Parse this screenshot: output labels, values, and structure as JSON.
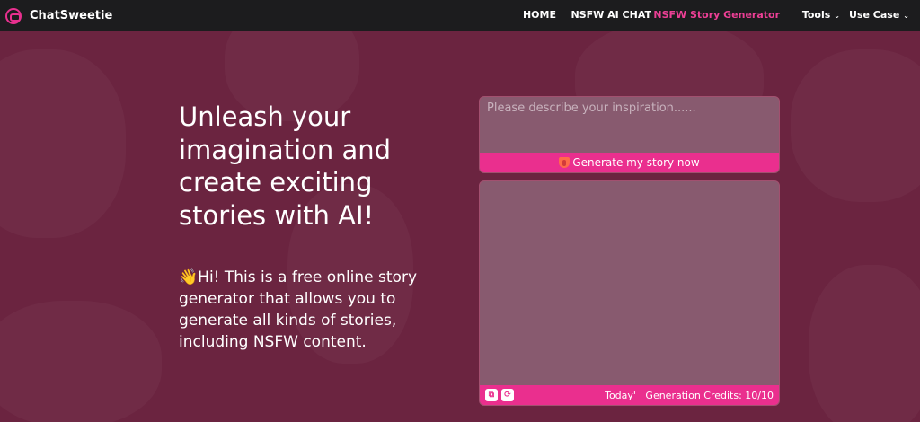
{
  "brand": {
    "name": "ChatSweetie",
    "logo_icon": "chat-bubble-icon",
    "accent": "#ea2f8e"
  },
  "nav": {
    "items": [
      {
        "label": "HOME",
        "active": false
      },
      {
        "label": "NSFW AI CHAT",
        "active": false
      },
      {
        "label": "NSFW Story Generator",
        "active": true
      },
      {
        "label": "Tools",
        "dropdown": true
      },
      {
        "label": "Use Case",
        "dropdown": true
      }
    ],
    "caret": "⌄"
  },
  "hero": {
    "title": "Unleash your imagination and create exciting stories with AI!",
    "description_emoji": "👋",
    "description": "Hi! This is a free online story generator that allows you to generate all kinds of stories, including NSFW content."
  },
  "input_card": {
    "placeholder": "Please describe your inspiration......",
    "generate_label": "Generate my story now",
    "generate_icon": "tongue-emoji-icon"
  },
  "output_card": {
    "tools": [
      {
        "icon": "copy-icon",
        "glyph": "⧉"
      },
      {
        "icon": "refresh-icon",
        "glyph": "⟳"
      }
    ],
    "credits_text": "Today'   Generation Credits: 10/10"
  },
  "colors": {
    "background": "#6b2440",
    "navbar": "#1c1c1e",
    "card": "#885a6f",
    "active_nav": "#ec3f95"
  }
}
